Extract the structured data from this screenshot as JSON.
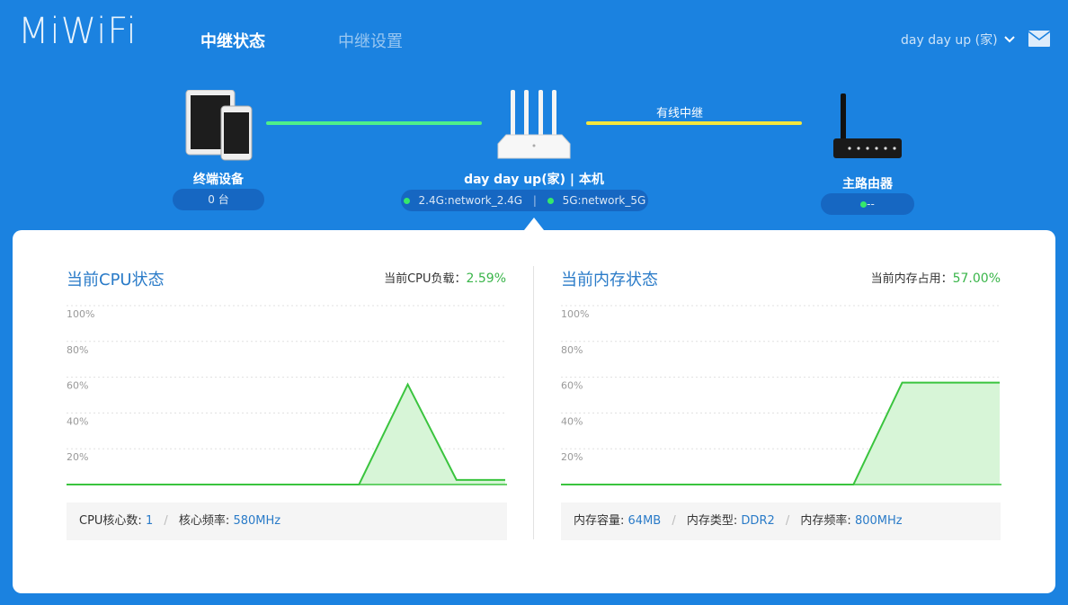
{
  "header": {
    "logo": "MiWiFi",
    "tabs": [
      {
        "label": "中继状态",
        "active": true
      },
      {
        "label": "中继设置",
        "active": false
      }
    ],
    "user": "day day up (家)"
  },
  "topology": {
    "devices": {
      "label": "终端设备",
      "count": "0 台"
    },
    "repeater": {
      "label": "day day up(家) | 本机",
      "band_24": "2.4G:network_2.4G",
      "band_5": "5G:network_5G"
    },
    "link_label": "有线中继",
    "main_router": {
      "label": "主路由器",
      "status": "--"
    }
  },
  "cpu": {
    "title": "当前CPU状态",
    "load_label": "当前CPU负载：",
    "load_value": "2.59%",
    "info": {
      "cores_label": "CPU核心数:",
      "cores": "1",
      "freq_label": "核心频率:",
      "freq": "580MHz"
    }
  },
  "memory": {
    "title": "当前内存状态",
    "usage_label": "当前内存占用：",
    "usage_value": "57.00%",
    "info": {
      "capacity_label": "内存容量:",
      "capacity": "64MB",
      "type_label": "内存类型:",
      "type": "DDR2",
      "freq_label": "内存频率:",
      "freq": "800MHz"
    }
  },
  "colors": {
    "accent": "#1b82e0",
    "line": "#3ac43e",
    "fill": "#d7f5d7",
    "link_green": "#4ef08a",
    "link_yellow": "#f5e63c"
  },
  "chart_data": [
    {
      "type": "area",
      "ylim": [
        0,
        100
      ],
      "yticks": [
        "20%",
        "40%",
        "60%",
        "80%",
        "100%"
      ],
      "x": [
        0,
        1,
        2,
        3,
        4,
        5,
        6,
        7,
        8,
        9
      ],
      "values": [
        0,
        0,
        0,
        0,
        0,
        0,
        0,
        56,
        2.6,
        2.59
      ]
    },
    {
      "type": "area",
      "ylim": [
        0,
        100
      ],
      "yticks": [
        "20%",
        "40%",
        "60%",
        "80%",
        "100%"
      ],
      "x": [
        0,
        1,
        2,
        3,
        4,
        5,
        6,
        7,
        8,
        9
      ],
      "values": [
        0,
        0,
        0,
        0,
        0,
        0,
        0,
        57,
        57,
        57
      ]
    }
  ]
}
